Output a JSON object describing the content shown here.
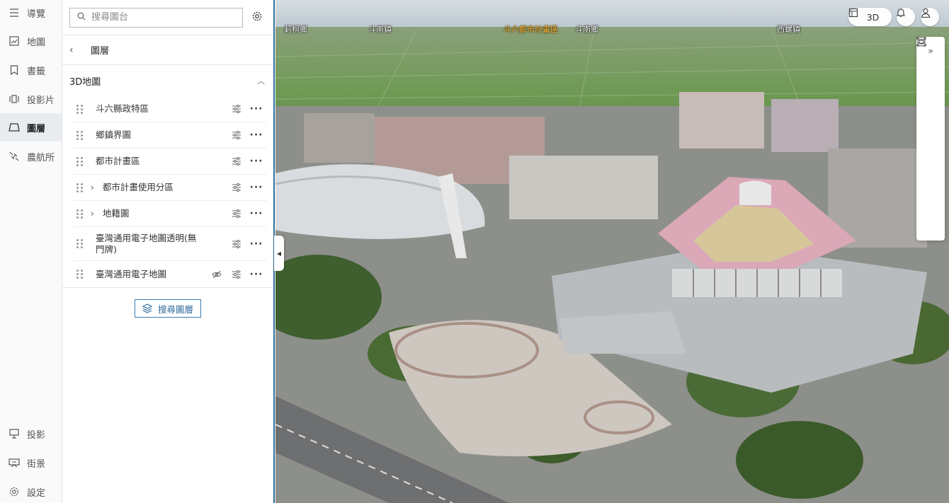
{
  "nav": {
    "top": [
      {
        "label": "導覽",
        "icon": "menu-icon"
      },
      {
        "label": "地圖",
        "icon": "map-icon"
      },
      {
        "label": "書籤",
        "icon": "bookmark-icon"
      },
      {
        "label": "投影片",
        "icon": "slides-icon"
      },
      {
        "label": "圖層",
        "icon": "layers-icon"
      },
      {
        "label": "農航所",
        "icon": "satellite-icon"
      }
    ],
    "bottom": [
      {
        "label": "投影",
        "icon": "projector-icon"
      },
      {
        "label": "街景",
        "icon": "street-view-icon"
      },
      {
        "label": "設定",
        "icon": "gear-icon"
      }
    ]
  },
  "panel": {
    "search_placeholder": "搜尋圖台",
    "breadcrumb": "圖層",
    "group_title": "3D地圖",
    "layers": [
      {
        "label": "斗六縣政特區",
        "expandable": false,
        "hidden": false
      },
      {
        "label": "鄉鎮界圖",
        "expandable": false,
        "hidden": false
      },
      {
        "label": "都市計畫區",
        "expandable": false,
        "hidden": false
      },
      {
        "label": "都市計畫使用分區",
        "expandable": true,
        "hidden": false
      },
      {
        "label": "地籍圖",
        "expandable": true,
        "hidden": false
      },
      {
        "label": "臺灣通用電子地圖透明(無門牌)",
        "expandable": false,
        "hidden": false
      },
      {
        "label": "臺灣通用電子地圖",
        "expandable": false,
        "hidden": true
      }
    ],
    "search_layers_label": "搜尋圖層"
  },
  "map": {
    "places": [
      {
        "label": "莿桐鄉",
        "orange": false
      },
      {
        "label": "斗南鎮",
        "orange": false
      },
      {
        "label": "斗六都市計畫區",
        "orange": true
      },
      {
        "label": "斗南鄉",
        "orange": false
      },
      {
        "label": "西螺鎮",
        "orange": false
      }
    ],
    "view_mode": "3D"
  },
  "colors": {
    "accent": "#2f6f9b",
    "active_nav": "#e9ecef"
  }
}
